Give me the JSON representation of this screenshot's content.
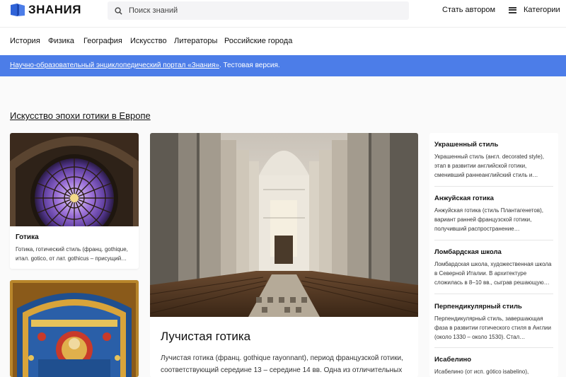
{
  "header": {
    "logo_text": "ЗНАНИЯ",
    "search_placeholder": "Поиск знаний",
    "author_label": "Стать автором",
    "categories_label": "Категории"
  },
  "nav": {
    "items": [
      "История",
      "Физика",
      "География",
      "Искусство",
      "Литераторы",
      "Российские города"
    ]
  },
  "banner": {
    "link_text": "Научно-образовательный энциклопедический портал «Знания»",
    "suffix_text": ". Тестовая версия."
  },
  "section": {
    "title": "Искусство эпохи готики в Европе"
  },
  "cards": [
    {
      "title": "Готика",
      "desc": "Готика, готический стиль (франц. gothique, итал. gotico, от лат. gothicus – присущий…"
    },
    {
      "title": "",
      "desc": ""
    }
  ],
  "feature": {
    "title": "Лучистая готика",
    "desc": "Лучистая готика (франц. gothique rayonnant), период французской готики, соответствующий середине 13 – середине 14 вв. Одна из отличительных"
  },
  "sidebar": [
    {
      "title": "Украшенный стиль",
      "desc": "Украшенный стиль (англ. decorated style), этап в развитии английской готики, сменивший раннеанглийский стиль и…"
    },
    {
      "title": "Анжуйская готика",
      "desc": "Анжуйская готика (стиль Плантагенетов), вариант ранней французской готики, получивший распространение…"
    },
    {
      "title": "Ломбардская школа",
      "desc": "Ломбардская школа, художественная школа в Северной Италии. В архитектуре сложилась в 8–10 вв., сыграв решающую…"
    },
    {
      "title": "Перпендикулярный стиль",
      "desc": "Перпендикулярный стиль, завершающая фаза в развитии готического стиля в Англии (около 1330 – около 1530). Стал…"
    },
    {
      "title": "Исабелино",
      "desc": "Исабелино (от исп. gótico isabelino),"
    }
  ],
  "colors": {
    "banner": "#4c7de8",
    "logo_blue": "#2f63d8"
  }
}
